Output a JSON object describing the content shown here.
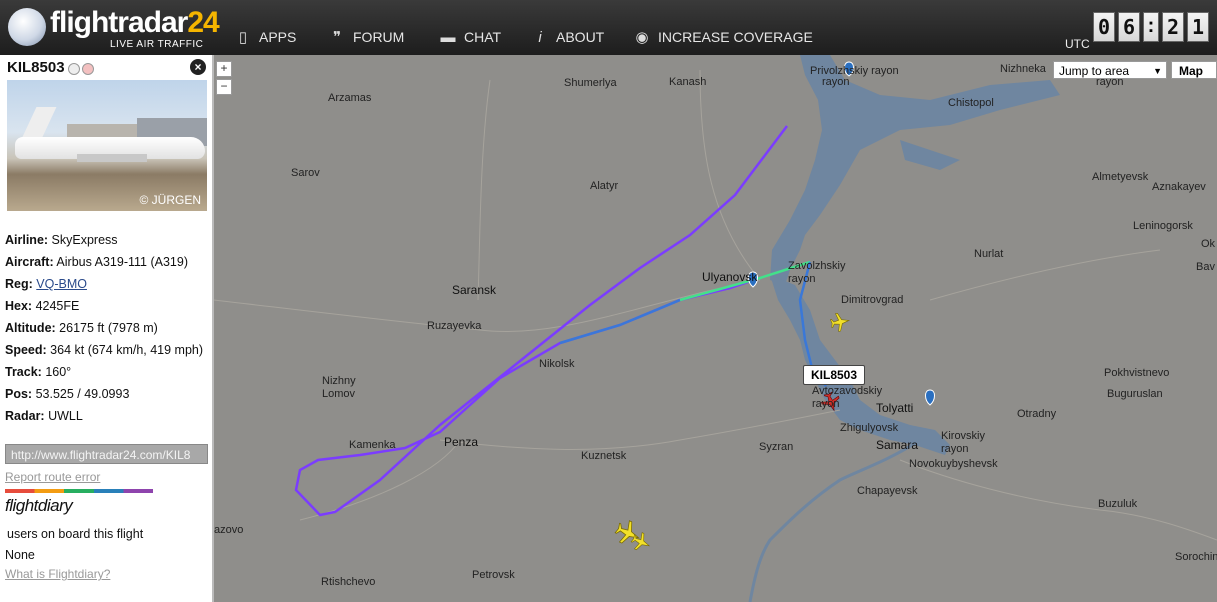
{
  "app": {
    "brand_main": "flightradar",
    "brand_num": "24",
    "tagline": "LIVE AIR TRAFFIC"
  },
  "nav": [
    {
      "label": "APPS",
      "icon": "phone-icon"
    },
    {
      "label": "FORUM",
      "icon": "quote-icon"
    },
    {
      "label": "CHAT",
      "icon": "chat-bubble-icon"
    },
    {
      "label": "ABOUT",
      "icon": "info-icon"
    },
    {
      "label": "INCREASE COVERAGE",
      "icon": "eye-icon"
    }
  ],
  "clock": {
    "utc_label": "UTC",
    "h1": "0",
    "h2": "6",
    "sep": ":",
    "m1": "2",
    "m2": "1"
  },
  "panel": {
    "callsign": "KIL8503",
    "photo_credit": "© JÜRGEN",
    "fields": {
      "airline_label": "Airline:",
      "airline": "SkyExpress",
      "aircraft_label": "Aircraft:",
      "aircraft": "Airbus A319-111 (A319)",
      "reg_label": "Reg:",
      "reg": "VQ-BMO",
      "hex_label": "Hex:",
      "hex": "4245FE",
      "altitude_label": "Altitude:",
      "altitude": "26175 ft (7978 m)",
      "speed_label": "Speed:",
      "speed": "364 kt (674 km/h, 419 mph)",
      "track_label": "Track:",
      "track": "160°",
      "pos_label": "Pos:",
      "pos": "53.525 / 49.0993",
      "radar_label": "Radar:",
      "radar": "UWLL"
    },
    "link": "http://www.flightradar24.com/KIL8",
    "report": "Report route error",
    "flightdiary_logo": "flightdiary",
    "fd_users": "users on board this flight",
    "fd_none": "None",
    "fd_what": "What is Flightdiary?"
  },
  "map": {
    "zoom_in": "+",
    "zoom_out": "−",
    "jump_label": "Jump to area",
    "map_type": "Map",
    "flight_label": "KIL8503",
    "cities": [
      "Privolzhskiy rayon",
      "Nizhneka",
      "rayon",
      "Kanash",
      "Shumerlya",
      "Arzamas",
      "Chistopol",
      "Sarov",
      "Alatyr",
      "Almetyevsk",
      "Aznakayev",
      "Leninogorsk",
      "Ulyanovsk",
      "Zavolzhskiy rayon",
      "Nurlat",
      "Saransk",
      "Dimitrovgrad",
      "Ruzayevka",
      "Nikolsk",
      "Pokhvistnevo",
      "Nizhny Lomov",
      "Avtozavodskiy rayon",
      "Tolyatti",
      "Buguruslan",
      "Otradny",
      "Kamenka",
      "Penza",
      "Syzran",
      "Zhigulyovsk",
      "Samara",
      "Kirovskiy rayon",
      "Kuznetsk",
      "Novokuybyshevsk",
      "Chapayevsk",
      "Buzuluk",
      "azovo",
      "Rtishchevo",
      "Petrovsk",
      "Sorochin",
      "Ok",
      "Bav"
    ]
  },
  "colors": {
    "track_purple": "#7b3cff",
    "track_blue": "#3a78d8",
    "track_green": "#43e08a",
    "aircraft_yellow": "#f2e02a",
    "aircraft_red": "#d0302a",
    "water": "#6f86a0"
  }
}
